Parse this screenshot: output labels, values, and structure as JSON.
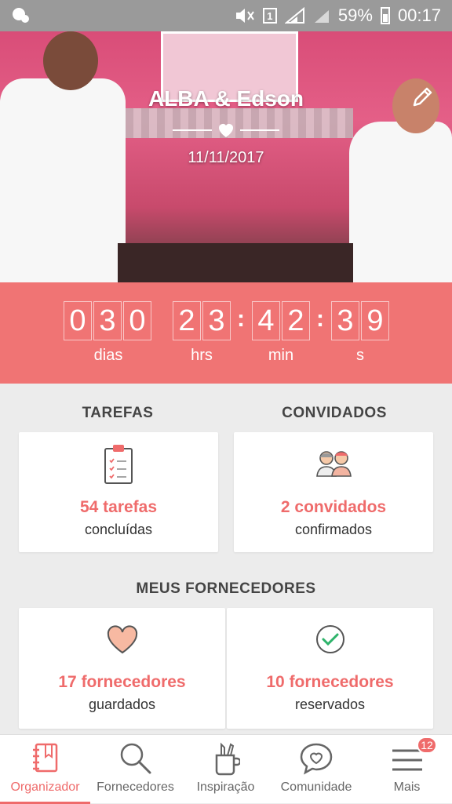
{
  "status_bar": {
    "battery_percent": "59%",
    "time": "00:17",
    "sim_label": "1",
    "icons": [
      "cloud-icon",
      "mute-icon",
      "signal-icon",
      "battery-icon"
    ]
  },
  "hero": {
    "title": "ALBA & Edson",
    "date": "11/11/2017"
  },
  "countdown": {
    "days": [
      "0",
      "3",
      "0"
    ],
    "hours": [
      "2",
      "3"
    ],
    "minutes": [
      "4",
      "2"
    ],
    "seconds": [
      "3",
      "9"
    ],
    "labels": {
      "days": "dias",
      "hours": "hrs",
      "minutes": "min",
      "seconds": "s"
    }
  },
  "tasks": {
    "title": "TAREFAS",
    "count": "54 tarefas",
    "sub": "concluídas"
  },
  "guests": {
    "title": "CONVIDADOS",
    "count": "2 convidados",
    "sub": "confirmados"
  },
  "vendors": {
    "title": "MEUS FORNECEDORES",
    "saved_count": "17 fornecedores",
    "saved_sub": "guardados",
    "booked_count": "10 fornecedores",
    "booked_sub": "reservados"
  },
  "nav": {
    "items": [
      {
        "label": "Organizador",
        "icon": "notebook-icon",
        "active": true
      },
      {
        "label": "Fornecedores",
        "icon": "search-icon",
        "active": false
      },
      {
        "label": "Inspiração",
        "icon": "pencil-cup-icon",
        "active": false
      },
      {
        "label": "Comunidade",
        "icon": "chat-heart-icon",
        "active": false
      },
      {
        "label": "Mais",
        "icon": "menu-icon",
        "active": false
      }
    ],
    "badge": "12"
  },
  "colors": {
    "accent": "#ef6b6b",
    "countdown_bg": "#f07474"
  }
}
